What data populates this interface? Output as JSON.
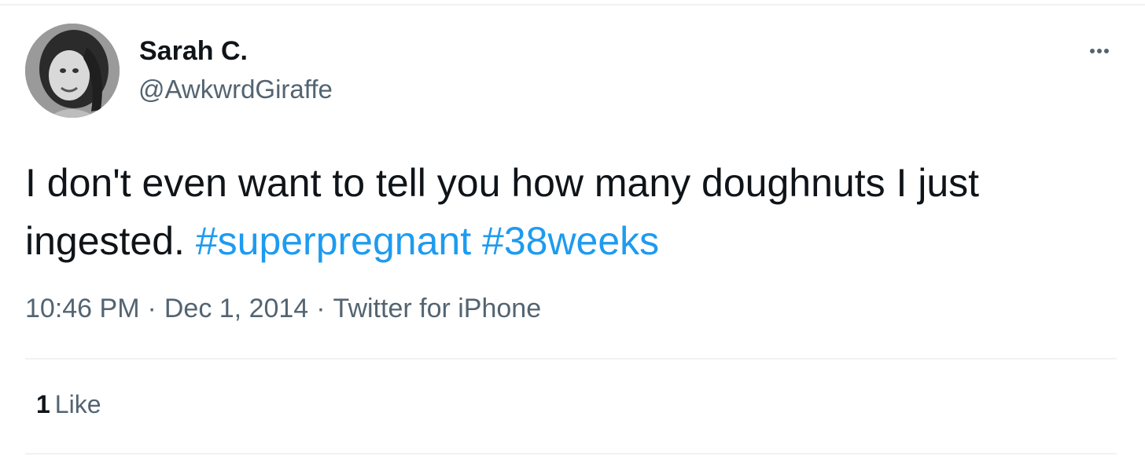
{
  "tweet": {
    "author": {
      "display_name": "Sarah C.",
      "handle": "@AwkwrdGiraffe"
    },
    "text_plain": "I don't even want to tell you how many doughnuts I just ingested. ",
    "hashtags": [
      "#superpregnant",
      "#38weeks"
    ],
    "time": "10:46 PM",
    "separator": "·",
    "date": "Dec 1, 2014",
    "source": "Twitter for iPhone",
    "stats": {
      "like_count": "1",
      "like_label": "Like"
    },
    "more_icon": "more-horizontal-icon"
  },
  "colors": {
    "text": "#0f1419",
    "secondary": "#536471",
    "link": "#1d9bf0",
    "divider": "#eff3f4"
  }
}
